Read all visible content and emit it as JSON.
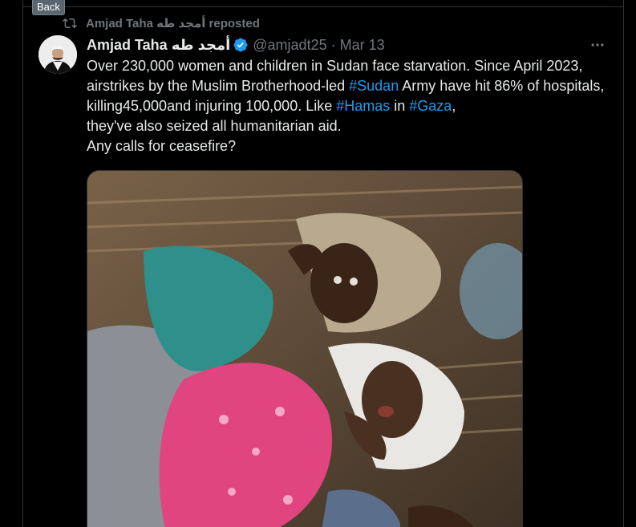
{
  "tooltip": {
    "label": "Back"
  },
  "repost": {
    "text": "Amjad Taha أمجد طه reposted",
    "icon": "repost-icon"
  },
  "tweet": {
    "display_name": "Amjad Taha أمجد طه",
    "handle": "@amjadt25",
    "separator": "·",
    "date": "Mar 13",
    "verified_icon": "verified-badge-icon",
    "more_icon": "more-options-icon",
    "text_parts": {
      "t1": "Over 230,000 women and children in Sudan face starvation. Since April 2023, airstrikes by the Muslim Brotherhood-led ",
      "h1": "#Sudan",
      "t2": " Army have hit 86% of hospitals, killing45,000and injuring 100,000. Like ",
      "h2": "#Hamas",
      "t3": " in ",
      "h3": "#Gaza",
      "t4": ",\nthey've also seized all humanitarian aid.\nAny calls for ceasefire?"
    }
  },
  "colors": {
    "background": "#000000",
    "text": "#e7e9ea",
    "muted": "#71767b",
    "link": "#1d9bf0",
    "border": "#2f3336"
  }
}
